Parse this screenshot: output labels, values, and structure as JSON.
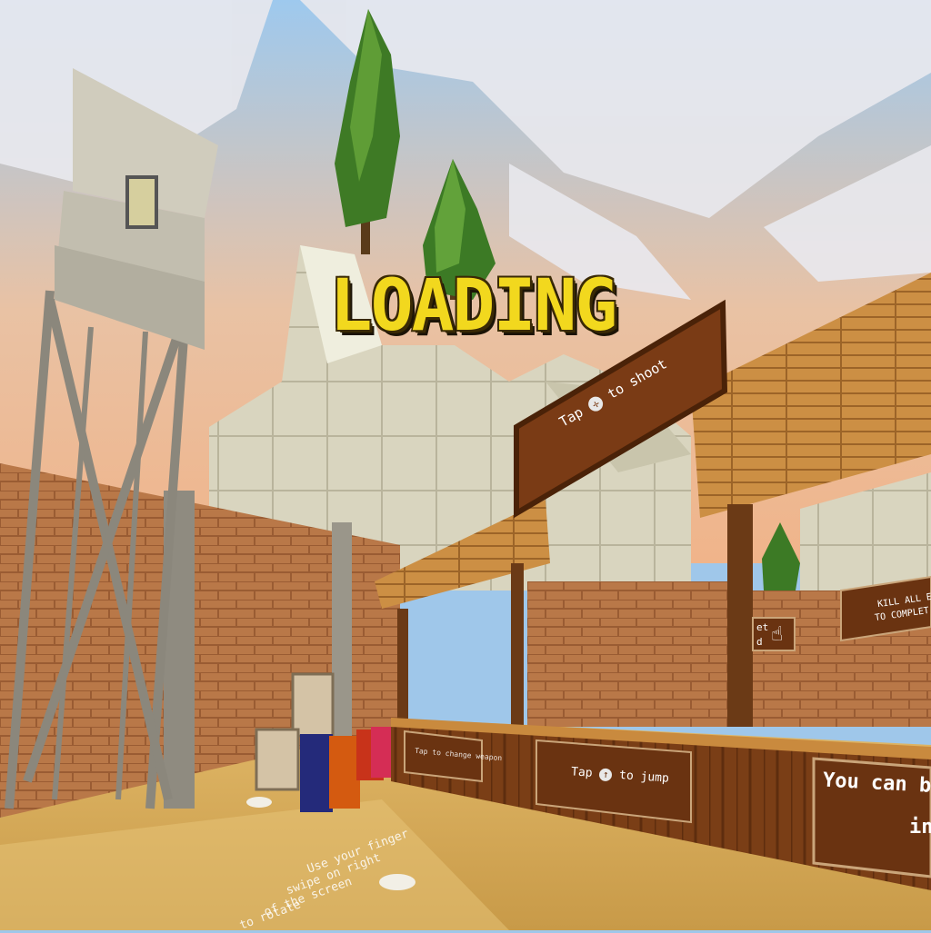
{
  "screen": {
    "title": "LOADING"
  },
  "signs": {
    "shoot": {
      "before": "Tap",
      "after": "to shoot"
    },
    "jump": {
      "before": "Tap",
      "after": "to jump"
    },
    "change_weapon": {
      "text": "Tap to change weapon"
    },
    "kill_all": {
      "line1": "KILL ALL E",
      "line2": "TO COMPLET"
    },
    "you_can_buy": {
      "line1": "You can bu",
      "line2": "in"
    },
    "partial": {
      "line1": "et",
      "line2": "d"
    }
  },
  "ground_text": {
    "line1": "Use your finger",
    "line2": "swipe on right",
    "line3": "of the screen",
    "line4": "to rotate"
  },
  "colors": {
    "loading_fill": "#f2d81e",
    "loading_outline": "#3a2a05",
    "sky": "#9fc7ea",
    "sand": "#d8b060",
    "brick": "#b9764a",
    "wood": "#c98a3e"
  }
}
